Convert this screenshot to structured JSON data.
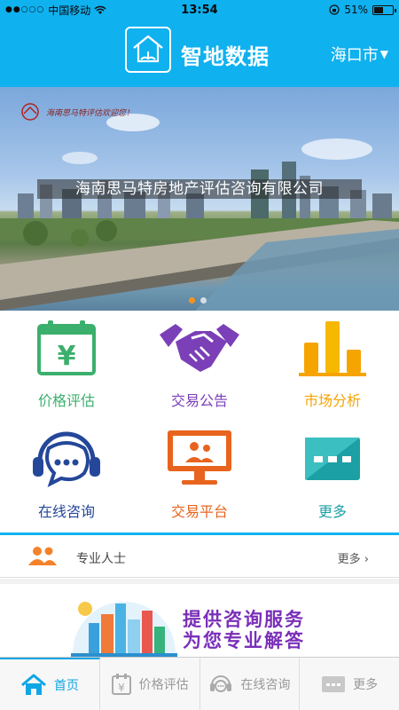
{
  "status_bar": {
    "carrier": "中国移动",
    "time": "13:54",
    "battery": "51%",
    "battery_level": 0.51
  },
  "header": {
    "title": "智地数据",
    "city": "海口市"
  },
  "banner": {
    "caption": "海南思马特房地产评估咨询有限公司",
    "logo_text": "海南思马特评估欢迎您！",
    "page_count": 2,
    "active_page": 1
  },
  "grid": [
    {
      "label": "价格评估",
      "icon": "price-calendar-icon",
      "color": "#3bb06d"
    },
    {
      "label": "交易公告",
      "icon": "handshake-icon",
      "color": "#7b3fb8"
    },
    {
      "label": "市场分析",
      "icon": "bar-chart-icon",
      "color": "#f6a400"
    },
    {
      "label": "在线咨询",
      "icon": "headset-chat-icon",
      "color": "#24479a"
    },
    {
      "label": "交易平台",
      "icon": "monitor-people-icon",
      "color": "#e8641e"
    },
    {
      "label": "更多",
      "icon": "more-dots-icon",
      "color": "#1ba0a6"
    }
  ],
  "professionals": {
    "label": "专业人士",
    "more": "更多"
  },
  "promo": {
    "line1": "提供咨询服务",
    "line2": "为您专业解答"
  },
  "tabbar": [
    {
      "label": "首页",
      "icon": "home-icon",
      "active": true
    },
    {
      "label": "价格评估",
      "icon": "calendar-icon",
      "active": false
    },
    {
      "label": "在线咨询",
      "icon": "headset-icon",
      "active": false
    },
    {
      "label": "更多",
      "icon": "more-icon",
      "active": false
    }
  ],
  "colors": {
    "primary": "#0fb1ef",
    "active_tab": "#0fa6e6",
    "pager_active": "#f5941d"
  }
}
